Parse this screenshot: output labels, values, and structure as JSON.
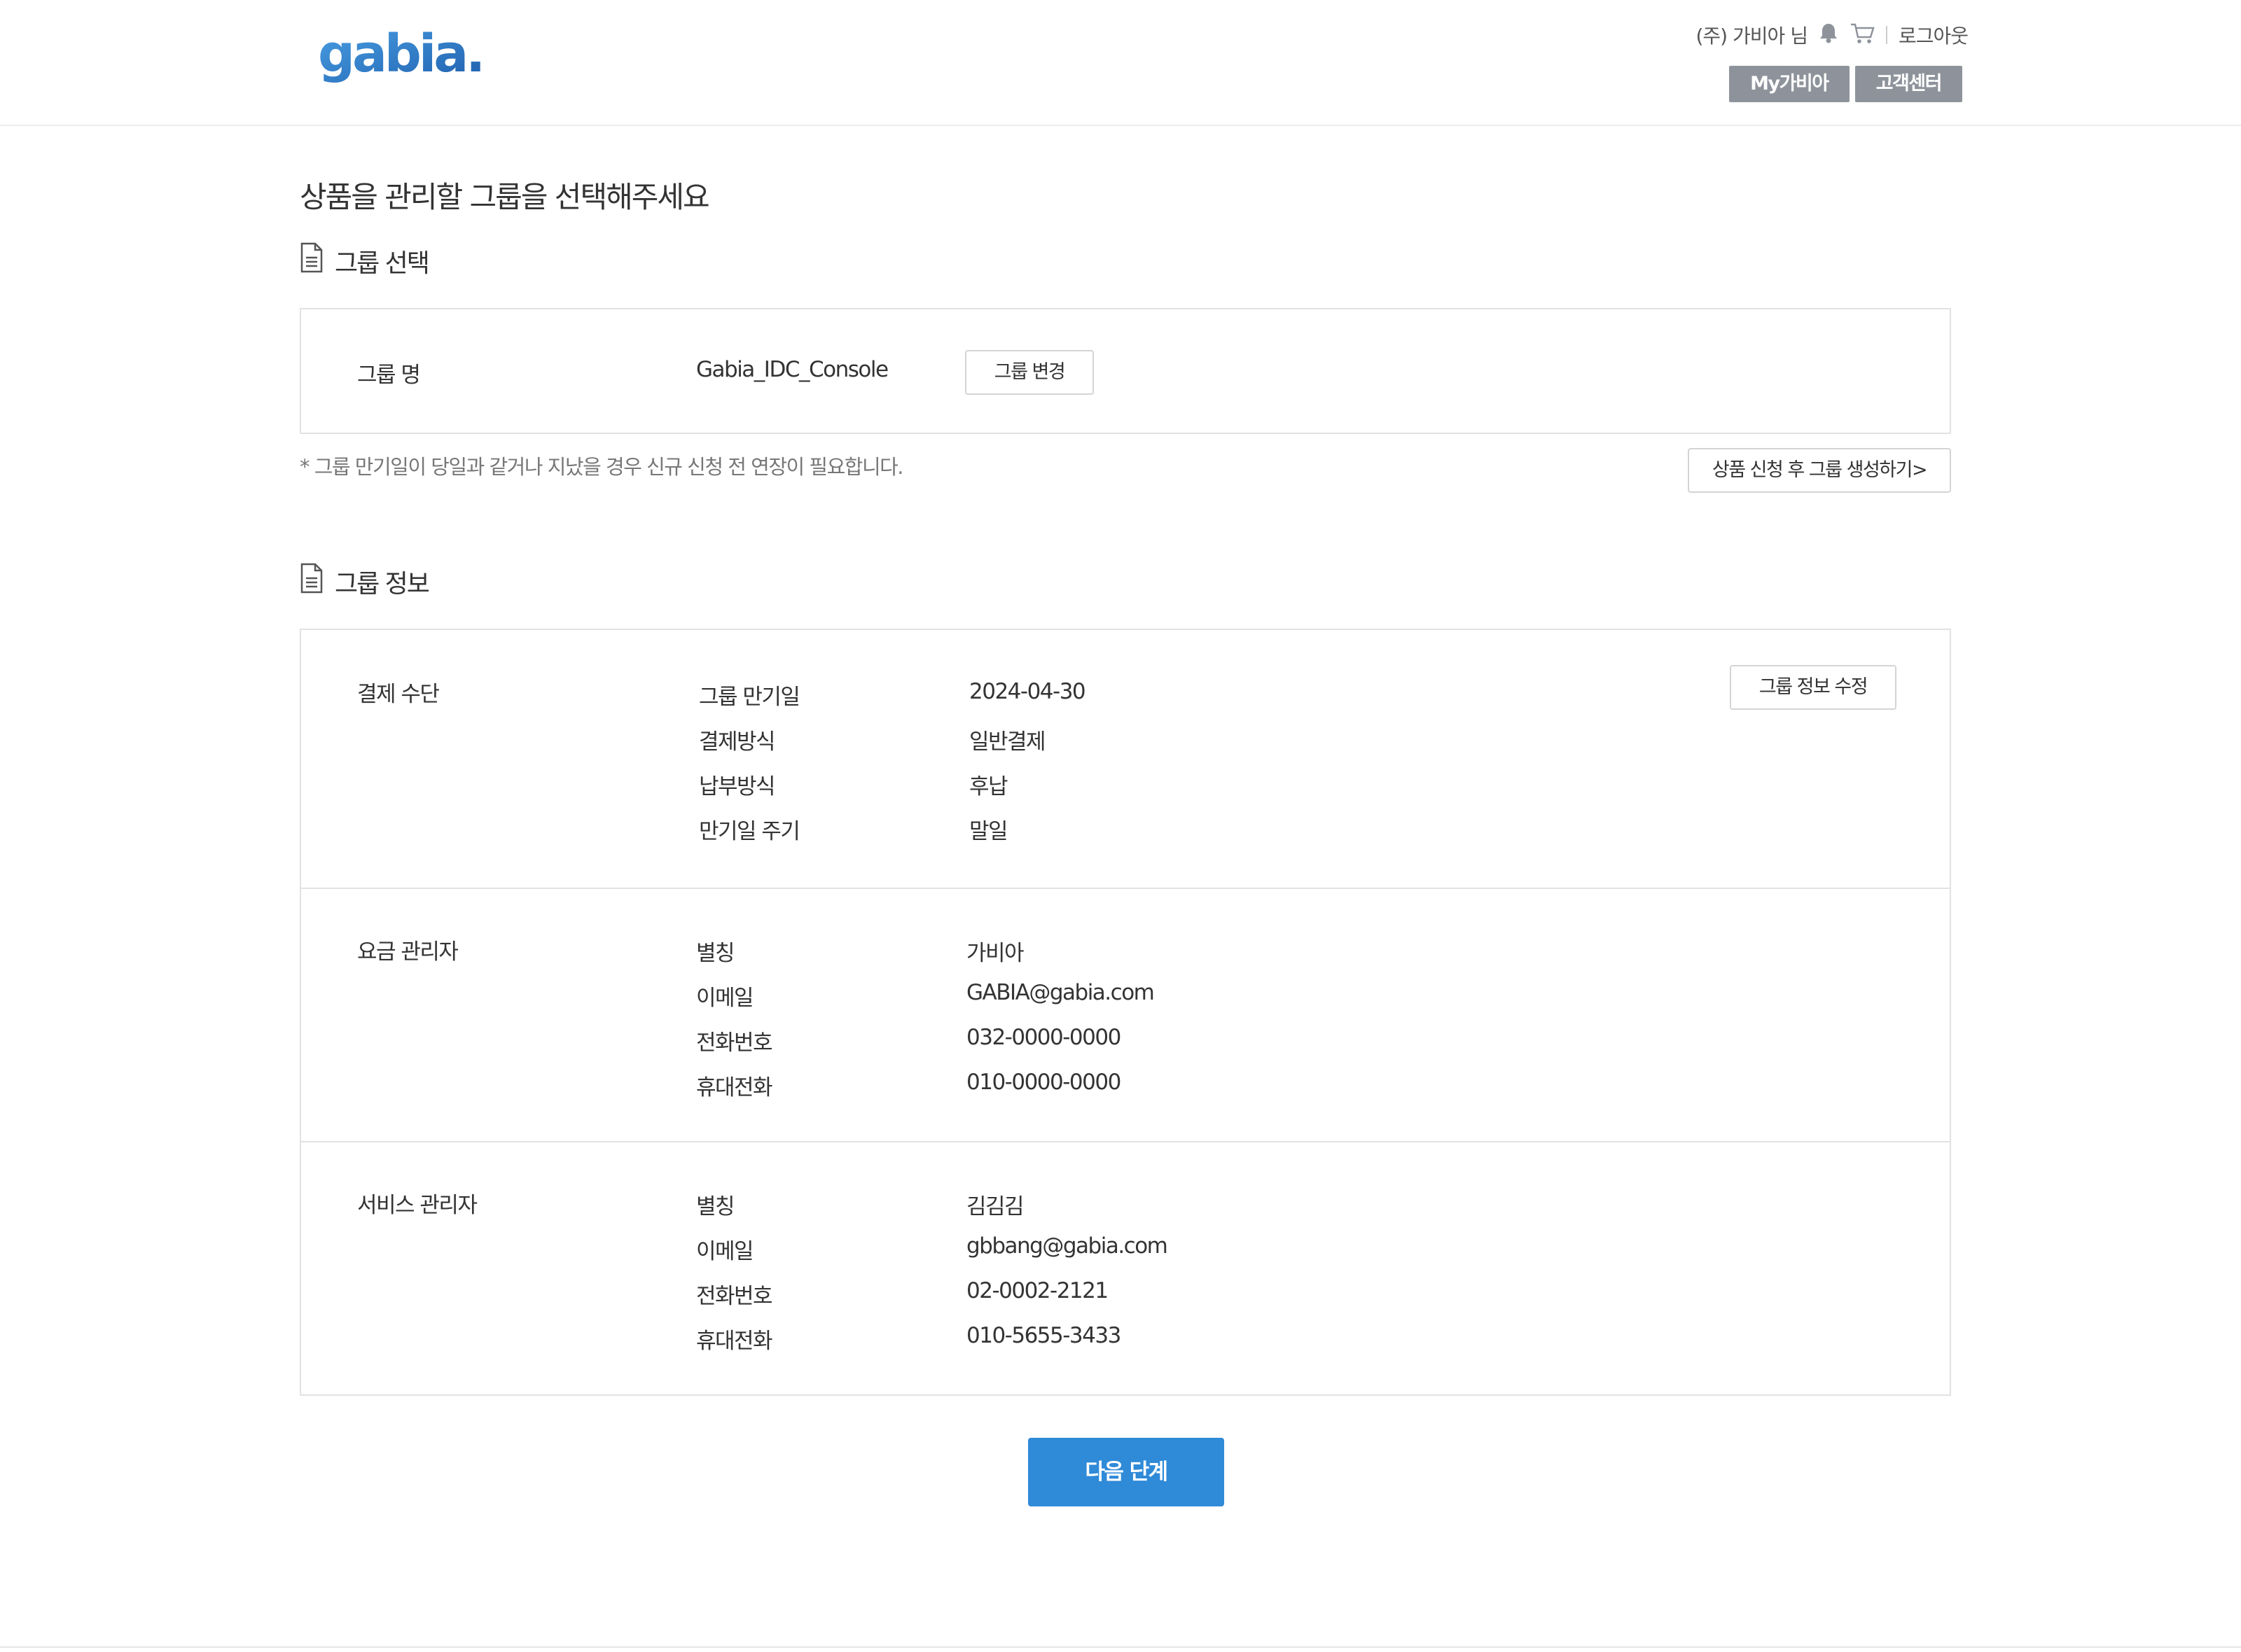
{
  "header": {
    "logo_text": "gabia.",
    "user_name": "(주) 가비아 님",
    "logout": "로그아웃",
    "my_gabia": "My가비아",
    "customer_center": "고객센터",
    "icons": [
      "bell-icon",
      "cart-icon"
    ],
    "button_color": "#8e939b"
  },
  "page": {
    "title": "상품을 관리할 그룹을 선택해주세요"
  },
  "group_select": {
    "section_title": "그룹 선택",
    "label": "그룹 명",
    "value": "Gabia_IDC_Console",
    "change_button": "그룹 변경",
    "note": "* 그룹 만기일이 당일과 같거나 지났을 경우 신규 신청 전 연장이 필요합니다.",
    "create_button": "상품 신청 후 그룹 생성하기>"
  },
  "group_info": {
    "section_title": "그룹 정보",
    "edit_button": "그룹 정보 수정",
    "payment": {
      "title": "결제 수단",
      "rows": [
        {
          "label": "그룹 만기일",
          "value": "2024-04-30"
        },
        {
          "label": "결제방식",
          "value": "일반결제"
        },
        {
          "label": "납부방식",
          "value": "후납"
        },
        {
          "label": "만기일 주기",
          "value": "말일"
        }
      ]
    },
    "billing_manager": {
      "title": "요금 관리자",
      "rows": [
        {
          "label": "별칭",
          "value": "가비아"
        },
        {
          "label": "이메일",
          "value": "GABIA@gabia.com"
        },
        {
          "label": "전화번호",
          "value": "032-0000-0000"
        },
        {
          "label": "휴대전화",
          "value": "010-0000-0000"
        }
      ]
    },
    "service_manager": {
      "title": "서비스 관리자",
      "rows": [
        {
          "label": "별칭",
          "value": "김김김"
        },
        {
          "label": "이메일",
          "value": "gbbang@gabia.com"
        },
        {
          "label": "전화번호",
          "value": "02-0002-2121"
        },
        {
          "label": "휴대전화",
          "value": "010-5655-3433"
        }
      ]
    }
  },
  "next_button": "다음 단계",
  "colors": {
    "primary": "#2f8ad8",
    "logo_blue": "#2a6fc0"
  }
}
